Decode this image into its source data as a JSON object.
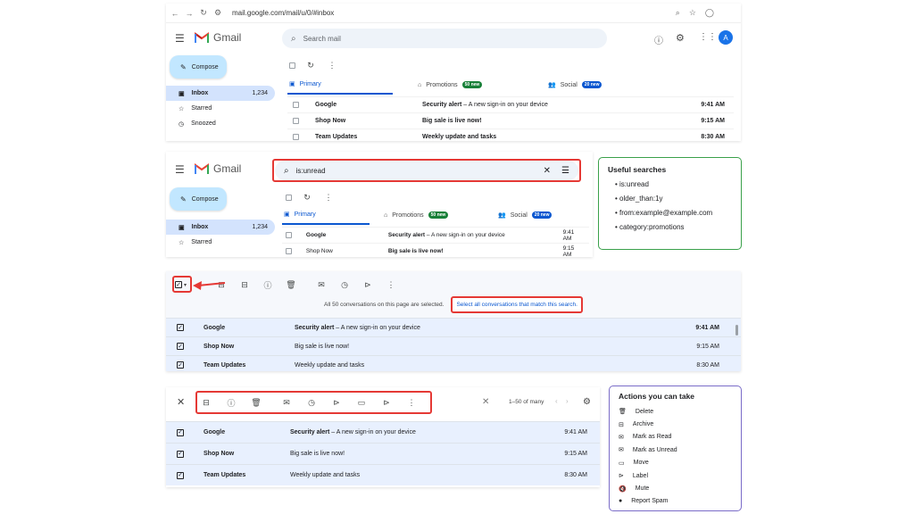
{
  "browser": {
    "url": "mail.google.com/mail/u/0/#inbox"
  },
  "app": {
    "name": "Gmail",
    "avatar_letter": "A"
  },
  "header": {
    "search_placeholder": "Search mail",
    "search_value": "is:unread"
  },
  "sidebar": {
    "compose_label": "Compose",
    "items": [
      {
        "label": "Inbox",
        "count": "1,234"
      },
      {
        "label": "Starred"
      },
      {
        "label": "Snoozed"
      }
    ]
  },
  "tabs": [
    {
      "label": "Primary"
    },
    {
      "label": "Promotions",
      "badge": "50 new",
      "badge_color": "#188038"
    },
    {
      "label": "Social",
      "badge": "20 new",
      "badge_color": "#0b57d0"
    }
  ],
  "emails": [
    {
      "sender": "Google",
      "subject": "Security alert",
      "snippet": " – A new sign-in on your device",
      "time": "9:41 AM"
    },
    {
      "sender": "Shop Now",
      "subject": "Big sale is live now!",
      "snippet": "",
      "time": "9:15 AM"
    },
    {
      "sender": "Team Updates",
      "subject": "Weekly update and tasks",
      "snippet": "",
      "time": "8:30 AM"
    }
  ],
  "useful_searches": {
    "title": "Useful searches",
    "items": [
      "is:unread",
      "older_than:1y",
      "from:example@example.com",
      "category:promotions"
    ]
  },
  "selection": {
    "notice": "All 50 conversations on this page are selected.",
    "link": "Select all conversations that match this search."
  },
  "pagination": {
    "range": "1–50 of many"
  },
  "actions": {
    "title": "Actions you can take",
    "items": [
      {
        "label": "Delete",
        "icon": "trash-icon"
      },
      {
        "label": "Archive",
        "icon": "archive-icon"
      },
      {
        "label": "Mark as Read",
        "icon": "mail-open-icon"
      },
      {
        "label": "Mark as Unread",
        "icon": "mail-icon"
      },
      {
        "label": "Move",
        "icon": "folder-icon"
      },
      {
        "label": "Label",
        "icon": "label-icon"
      },
      {
        "label": "Mute",
        "icon": "mute-icon"
      },
      {
        "label": "Report Spam",
        "icon": "spam-icon"
      }
    ]
  },
  "colors": {
    "accent": "#0b57d0",
    "highlight": "#e53935",
    "green_box": "#3aa04a",
    "purple_box": "#7a6cc8"
  }
}
